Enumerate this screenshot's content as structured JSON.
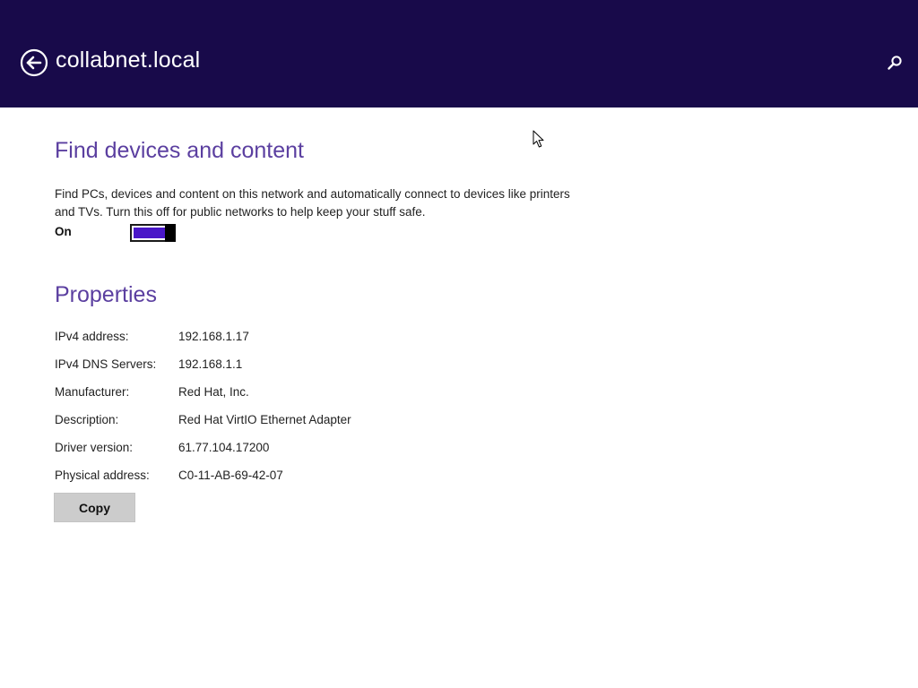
{
  "header": {
    "title": "collabnet.local",
    "background_color": "#180a4a",
    "back_icon": "back-arrow-circle-icon",
    "search_icon": "search-icon"
  },
  "find_devices": {
    "title": "Find devices and content",
    "description": "Find PCs, devices and content on this network and automatically connect to devices like printers and TVs. Turn this off for public networks to help keep your stuff safe.",
    "toggle_state_label": "On",
    "toggle_on": true,
    "toggle_color": "#4a17c8"
  },
  "properties": {
    "title": "Properties",
    "rows": [
      {
        "label": "IPv4 address:",
        "value": "192.168.1.17"
      },
      {
        "label": "IPv4 DNS Servers:",
        "value": "192.168.1.1"
      },
      {
        "label": "Manufacturer:",
        "value": "Red Hat, Inc."
      },
      {
        "label": "Description:",
        "value": "Red Hat VirtIO Ethernet Adapter"
      },
      {
        "label": "Driver version:",
        "value": "61.77.104.17200"
      },
      {
        "label": "Physical address:",
        "value": "C0-11-AB-69-42-07"
      }
    ],
    "copy_label": "Copy"
  },
  "accent_color": "#5b3fa0"
}
